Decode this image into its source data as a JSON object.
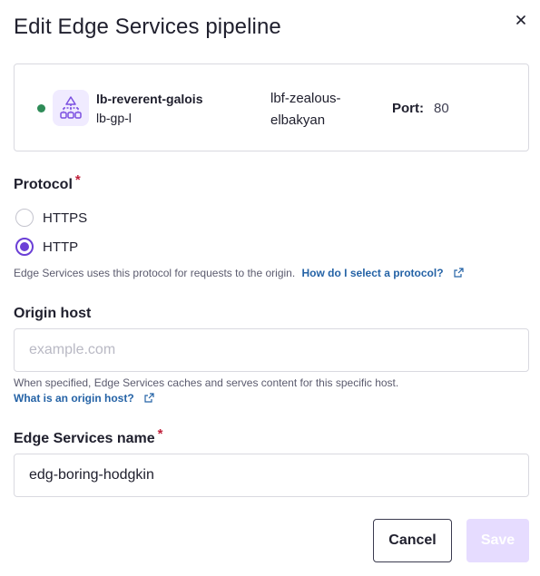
{
  "dialog": {
    "title": "Edit Edge Services pipeline",
    "close_label": "×"
  },
  "resource": {
    "status_color": "#2e8b57",
    "icon": "load-balancer-icon",
    "lb_name": "lb-reverent-galois",
    "lb_sub": "lb-gp-l",
    "backend": "lbf-zealous-elbakyan",
    "port_label": "Port:",
    "port_value": "80"
  },
  "protocol": {
    "label": "Protocol",
    "required_mark": "*",
    "options": [
      {
        "label": "HTTPS",
        "checked": false
      },
      {
        "label": "HTTP",
        "checked": true
      }
    ],
    "help_text": "Edge Services uses this protocol for requests to the origin.",
    "help_link": "How do I select a protocol?"
  },
  "origin_host": {
    "label": "Origin host",
    "placeholder": "example.com",
    "value": "",
    "help_text": "When specified, Edge Services caches and serves content for this specific host.",
    "help_link": "What is an origin host?"
  },
  "edge_name": {
    "label": "Edge Services name",
    "required_mark": "*",
    "value": "edg-boring-hodgkin"
  },
  "actions": {
    "cancel": "Cancel",
    "save": "Save"
  },
  "colors": {
    "accent": "#6b3fd6",
    "link": "#2563a6",
    "required": "#c0213b",
    "save_disabled_bg": "#e6dcff"
  }
}
